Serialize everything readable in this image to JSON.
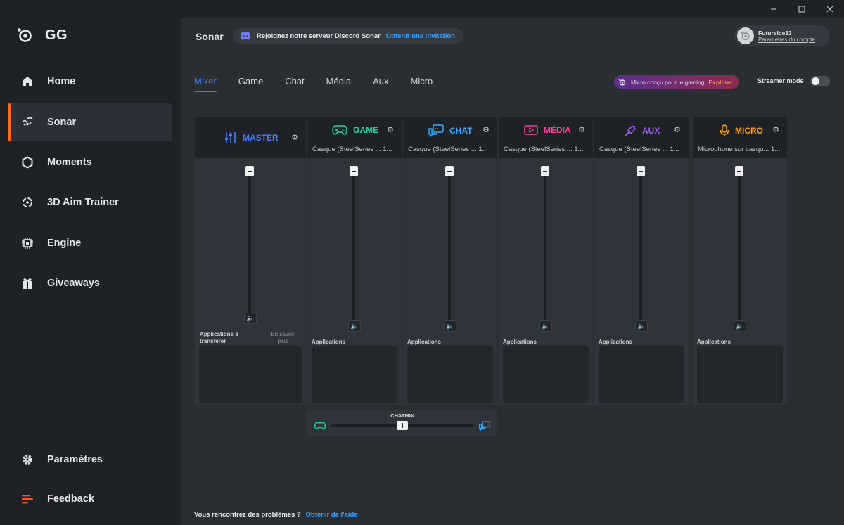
{
  "window": {
    "min_icon": "minimize-icon",
    "max_icon": "maximize-icon",
    "close_icon": "close-icon"
  },
  "brand": {
    "title": "GG"
  },
  "sidebar": {
    "items": [
      {
        "label": "Home",
        "icon": "home-icon"
      },
      {
        "label": "Sonar",
        "icon": "sonar-icon",
        "active": true
      },
      {
        "label": "Moments",
        "icon": "hexagon-icon"
      },
      {
        "label": "3D Aim Trainer",
        "icon": "crosshair-icon"
      },
      {
        "label": "Engine",
        "icon": "chip-icon"
      },
      {
        "label": "Giveaways",
        "icon": "gift-icon"
      }
    ],
    "bottom": [
      {
        "label": "Paramètres",
        "icon": "gear-icon"
      },
      {
        "label": "Feedback",
        "icon": "feedback-icon"
      }
    ]
  },
  "header": {
    "crumb": "Sonar",
    "discord_text": "Rejoignez notre serveur Discord Sonar",
    "discord_link": "Obtenir une invitation",
    "account_name": "FutureIce33",
    "account_link": "Paramètres du compte"
  },
  "tabs": [
    "Mixer",
    "Game",
    "Chat",
    "Média",
    "Aux",
    "Micro"
  ],
  "active_tab": "Mixer",
  "promo": {
    "text": "Micro conçu pour le gaming",
    "link": "Explorer"
  },
  "streamer": {
    "label": "Streamer mode",
    "on": false
  },
  "colors": {
    "accent": "#3c7df0",
    "sonar_orange": "#ff6a1f",
    "master": "#4a7bff",
    "game": "#22d3a0",
    "chat": "#3aa8ff",
    "media": "#ff3e9a",
    "aux": "#a05bff",
    "micro": "#ff9f1a"
  },
  "master": {
    "label": "MASTER",
    "apps_label": "Applications à transférer",
    "learn_more": "En savoir plus"
  },
  "channels": [
    {
      "label": "GAME",
      "device": "Casque (SteelSeries ... 1...",
      "apps_label": "Applications"
    },
    {
      "label": "CHAT",
      "device": "Casque (SteelSeries ... 1...",
      "apps_label": "Applications"
    },
    {
      "label": "MÉDIA",
      "device": "Casque (SteelSeries ... 1...",
      "apps_label": "Applications"
    },
    {
      "label": "AUX",
      "device": "Casque (SteelSeries ... 1...",
      "apps_label": "Applications"
    },
    {
      "label": "MICRO",
      "device": "Microphone sur casqu... 1...",
      "apps_label": "Applications"
    }
  ],
  "chatmix": {
    "label": "CHATMIX",
    "balance": 0.5
  },
  "help": {
    "question": "Vous rencontrez des problèmes ?",
    "link": "Obtenir de l'aide"
  }
}
